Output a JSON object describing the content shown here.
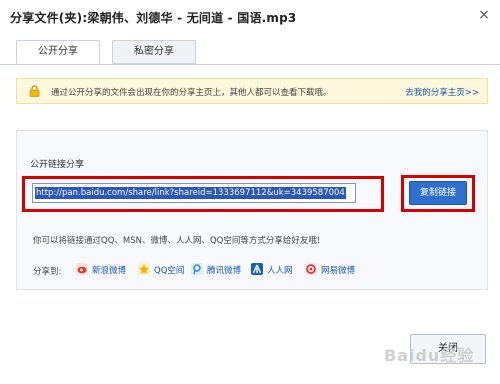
{
  "dialog": {
    "title": "分享文件(夹):梁朝伟、刘德华 - 无间道 - 国语.mp3",
    "close_glyph": "×"
  },
  "tabs": [
    {
      "label": "公开分享",
      "active": true
    },
    {
      "label": "私密分享",
      "active": false
    }
  ],
  "notice": {
    "text": "通过公开分享的文件会出现在你的分享主页上，其他人都可以查看下载哦。",
    "link": "去我的分享主页>>"
  },
  "share_link": {
    "label": "公开链接分享",
    "url": "http://pan.baidu.com/share/link?shareid=1333697112&uk=3439587004",
    "copy_button": "复制链接"
  },
  "hint": "你可以将链接通过QQ、MSN、微博、人人网、QQ空间等方式分享给好友哦!",
  "share_to": {
    "label": "分享到:",
    "services": [
      {
        "name": "新浪微博",
        "icon": "sina-weibo-icon",
        "color": "#e2372b"
      },
      {
        "name": "QQ空间",
        "icon": "qzone-icon",
        "color": "#f2b400"
      },
      {
        "name": "腾讯微博",
        "icon": "tencent-weibo-icon",
        "color": "#2a8fd6"
      },
      {
        "name": "人人网",
        "icon": "renren-icon",
        "color": "#1a5fb4"
      },
      {
        "name": "网易微博",
        "icon": "netease-weibo-icon",
        "color": "#d8262b"
      }
    ]
  },
  "footer": {
    "close_label": "关闭"
  },
  "watermark": "Baidu经验",
  "colors": {
    "highlight_box": "#d50000",
    "primary_button": "#2f6fd0",
    "link": "#1a55b6",
    "notice_bg": "#fff8dc"
  }
}
